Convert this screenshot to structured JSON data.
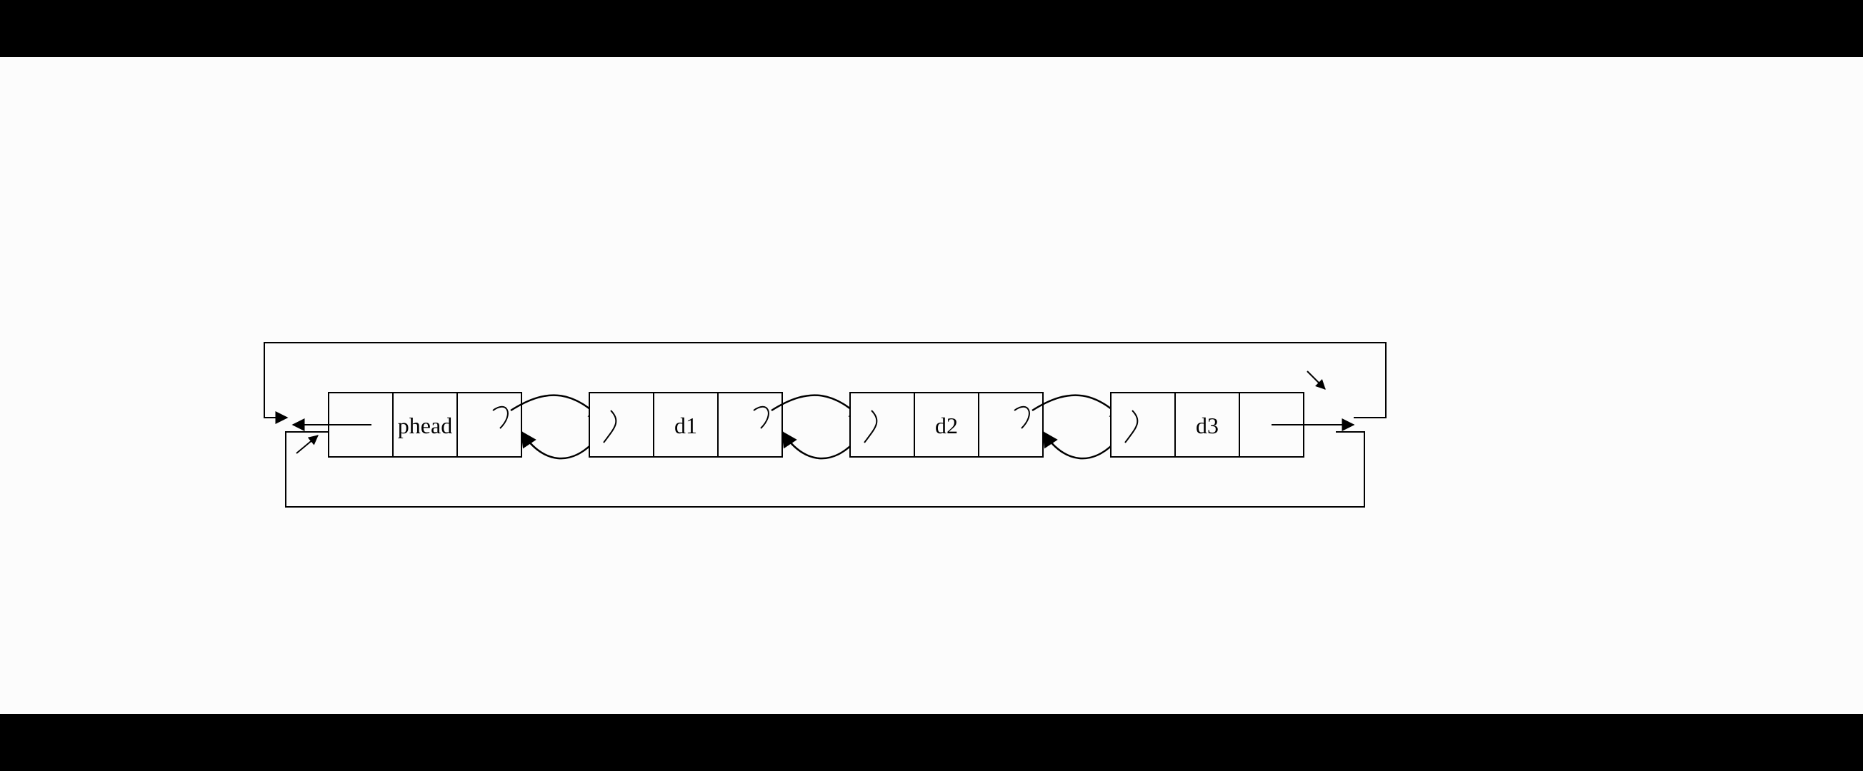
{
  "diagram": {
    "type": "circular-doubly-linked-list",
    "nodes": [
      {
        "label": "phead"
      },
      {
        "label": "d1"
      },
      {
        "label": "d2"
      },
      {
        "label": "d3"
      }
    ]
  }
}
